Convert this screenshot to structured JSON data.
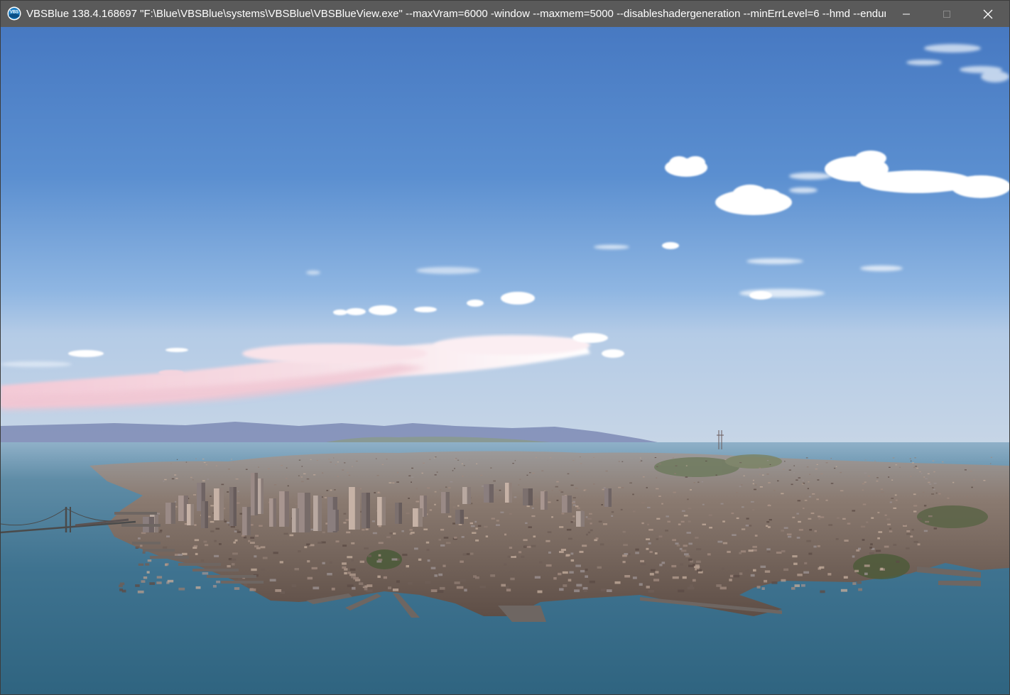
{
  "window": {
    "title": "VBSBlue 138.4.168697 \"F:\\Blue\\VBSBlue\\systems\\VBSBlue\\VBSBlueView.exe\" --maxVram=6000 -window --maxmem=5000 --disableshadergeneration --minErrLevel=6 --hmd --endur...",
    "app_icon": "vbs-app-icon",
    "app_icon_text": "VBS",
    "controls": {
      "minimize_icon": "minimize-icon",
      "maximize_icon": "maximize-icon",
      "close_icon": "close-icon"
    }
  },
  "scene": {
    "description_icon": "3d-city-render",
    "colors": {
      "sky_top": "#4a82c8",
      "sky_horizon": "#b9cfe6",
      "water": "#3a6f8a",
      "city": "#7a6a60",
      "titlebar": "#5a5a5a"
    }
  }
}
